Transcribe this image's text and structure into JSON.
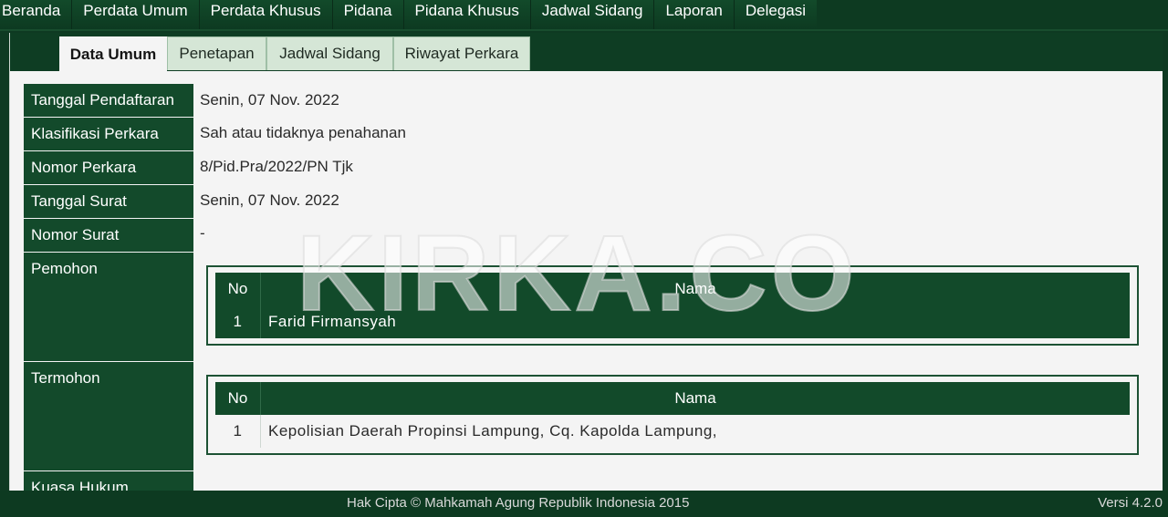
{
  "nav": {
    "items": [
      "Beranda",
      "Perdata Umum",
      "Perdata Khusus",
      "Pidana",
      "Pidana Khusus",
      "Jadwal Sidang",
      "Laporan",
      "Delegasi"
    ]
  },
  "tabs": [
    {
      "label": "Data Umum",
      "active": true
    },
    {
      "label": "Penetapan",
      "active": false
    },
    {
      "label": "Jadwal Sidang",
      "active": false
    },
    {
      "label": "Riwayat Perkara",
      "active": false
    }
  ],
  "fields": [
    {
      "label": "Tanggal Pendaftaran",
      "value": "Senin, 07 Nov. 2022"
    },
    {
      "label": "Klasifikasi Perkara",
      "value": "Sah atau tidaknya penahanan"
    },
    {
      "label": "Nomor Perkara",
      "value": "8/Pid.Pra/2022/PN Tjk"
    },
    {
      "label": "Tanggal Surat",
      "value": "Senin, 07 Nov. 2022"
    },
    {
      "label": "Nomor Surat",
      "value": "-"
    }
  ],
  "pemohon": {
    "label": "Pemohon",
    "headers": {
      "no": "No",
      "name": "Nama"
    },
    "rows": [
      {
        "no": "1",
        "name": "Farid Firmansyah"
      }
    ]
  },
  "termohon": {
    "label": "Termohon",
    "headers": {
      "no": "No",
      "name": "Nama"
    },
    "rows": [
      {
        "no": "1",
        "name": "Kepolisian Daerah Propinsi Lampung, Cq. Kapolda Lampung,"
      }
    ]
  },
  "kuasa_hukum": {
    "label": "Kuasa Hukum"
  },
  "footer": {
    "copyright": "Hak Cipta © Mahkamah Agung Republik Indonesia 2015",
    "version": "Versi 4.2.0"
  },
  "watermark": "KIRKA.CO",
  "colors": {
    "primary_green": "#124a2a",
    "nav_green": "#0d3a21",
    "tab_inactive": "#d5e6d6"
  }
}
